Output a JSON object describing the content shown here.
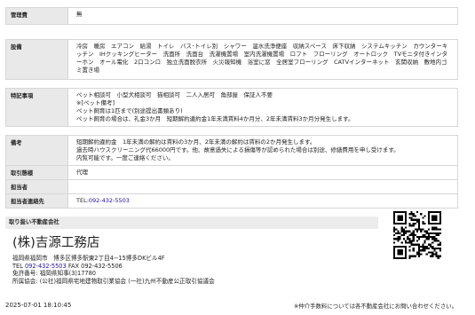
{
  "spec": {
    "management": {
      "label": "管理費",
      "value": "無"
    },
    "equipment": {
      "label": "設備",
      "value": "冷房　暖房　エアコン　給湯　トイレ　バス･トイレ別　シャワー　温水洗浄便座　収納スペース　床下収納　システムキッチン　カウンターキッチン　IHクッキングヒーター　洗面所　洗面台　洗濯機置場　室内洗濯機置場　ロフト　フローリング　オートロック　TVモニタ付きインターホン　オール電化　2口コンロ　独立洗面脱衣所　火災報知機　浴室に窓　全居室フローリング　CATVインターネット　玄関収納　敷地内ゴミ置き場"
    },
    "special": {
      "label": "特記事項",
      "lines": [
        "ペット相談可　小型犬相談可　猫相談可　二人入居可　角部屋　保証人不要",
        "※[ペット備考]",
        "ペット飼育は1匹まで(別途提出書類あり)",
        "ペット飼育の場合は、礼金3か月　短期解約違約金1年未満賃料4か月分、2年未満賃料3か月分発生します。"
      ]
    },
    "remarks": {
      "label": "備考",
      "lines": [
        "短期解約違約金　1年未満の解約は賃料の3か月、2年未満の解約は賃料の2か月発生します。",
        "過去時ハウスクリーニング代66000円です。他、故意過失による損傷等が認められた場合は別途、修繕費用を申し受けます。",
        "内覧可能です。一度ご連絡ください。"
      ]
    },
    "transaction": {
      "label": "取引態様",
      "value": "代理"
    },
    "staff": {
      "label": "担当者",
      "value": ""
    },
    "contact": {
      "label": "担当者連絡先",
      "prefix": "TEL:",
      "phone": "092-432-5503"
    }
  },
  "dealer": {
    "header": "取り扱い不動産会社",
    "name": "(株)吉源工務店",
    "address": "福岡県福岡市　博多区博多駅東2丁目4−15博多DKビル4F",
    "tel_label": "TEL",
    "tel": "092-432-5503",
    "fax": "FAX 092-432-5506",
    "license": "免許番号: 福岡県知事(3)17780",
    "association": "所属協会: (公社)福岡県宅地建物取引業協会 (一社)九州不動産公正取引協議会"
  },
  "footer": {
    "timestamp": "2025-07-01 18:10:45",
    "note": "※仲介手数料については各不動産会社にお問い合わせください。"
  },
  "colors": {
    "header_bg": "#e9e9e9",
    "border": "#d7d7d7",
    "link": "#1a0dab"
  },
  "icons": {
    "qr": "qr-code-icon"
  }
}
